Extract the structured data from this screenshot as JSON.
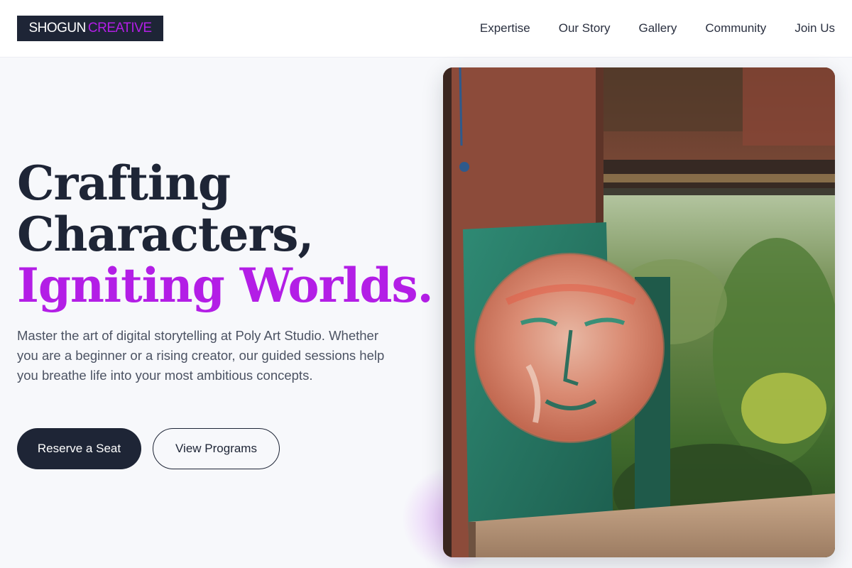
{
  "header": {
    "logo_word1": "SHOGUN",
    "logo_word2": "CREATIVE",
    "nav": [
      "Expertise",
      "Our Story",
      "Gallery",
      "Community",
      "Join Us"
    ]
  },
  "hero": {
    "headline_line1": "Crafting",
    "headline_line2": "Characters,",
    "headline_line3": "Igniting Worlds.",
    "lead": "Master the art of digital storytelling at Poly Art Studio. Whether you are a beginner or a rising creator, our guided sessions help you breathe life into your most ambitious concepts.",
    "primary_cta": "Reserve a Seat",
    "secondary_cta": "View Programs"
  },
  "colors": {
    "navy": "#1e2536",
    "accent": "#b31ee6",
    "background": "#f7f8fb"
  }
}
